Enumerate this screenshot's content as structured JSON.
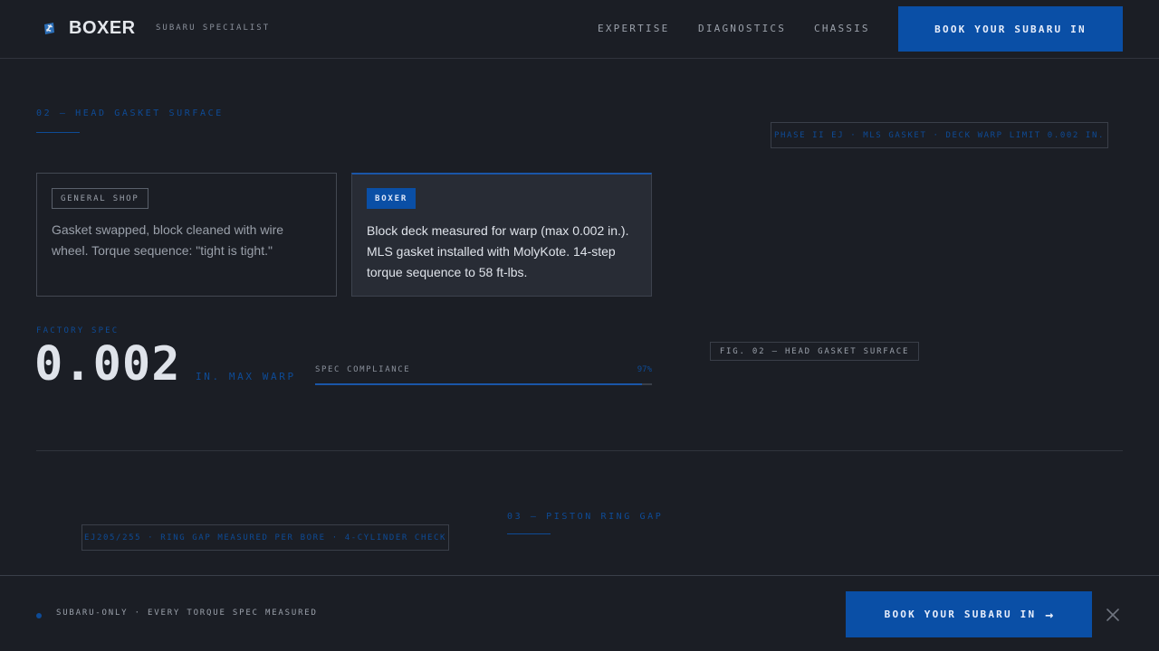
{
  "header": {
    "brand": "BOXER",
    "tagline": "SUBARU SPECIALIST",
    "nav": [
      "EXPERTISE",
      "DIAGNOSTICS",
      "CHASSIS"
    ],
    "cta": "BOOK YOUR SUBARU IN",
    "logo_icon": "wrench-icon"
  },
  "section_02": {
    "label": "02 — HEAD GASKET SURFACE",
    "meta": "PHASE II EJ · MLS GASKET · DECK WARP LIMIT 0.002 IN.",
    "cards": [
      {
        "badge": "GENERAL SHOP",
        "text": "Gasket swapped, block cleaned with wire wheel. Torque sequence: \"tight is tight.\""
      },
      {
        "badge": "BOXER",
        "text": "Block deck measured for warp (max 0.002 in.). MLS gasket installed with MolyKote. 14-step torque sequence to 58 ft-lbs."
      }
    ],
    "spec": {
      "label": "FACTORY SPEC",
      "value": "0.002",
      "unit": "IN. MAX WARP",
      "compliance_label": "SPEC COMPLIANCE",
      "compliance_text": "97%",
      "compliance_value": 97
    },
    "figure_caption": "FIG. 02 — HEAD GASKET SURFACE"
  },
  "section_03": {
    "label": "03 — PISTON RING GAP",
    "meta": "EJ205/255 · RING GAP MEASURED PER BORE · 4-CYLINDER CHECK"
  },
  "bottom_bar": {
    "text": "SUBARU-ONLY · EVERY TORQUE SPEC MEASURED",
    "cta": "BOOK YOUR SUBARU IN",
    "arrow": "→"
  },
  "colors": {
    "accent": "#0a4fa6",
    "accent_text": "#0e4b96",
    "background": "#1b1e25"
  }
}
